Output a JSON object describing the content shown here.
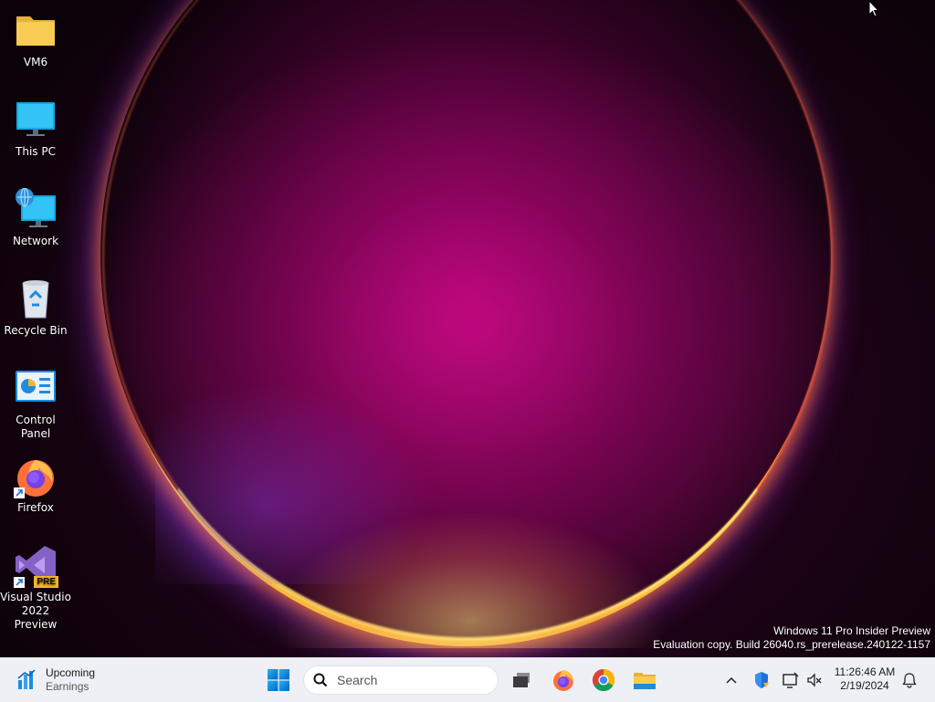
{
  "desktop": {
    "icons": [
      {
        "label": "VM6",
        "icon": "folder-icon"
      },
      {
        "label": "This PC",
        "icon": "monitor-icon"
      },
      {
        "label": "Network",
        "icon": "network-icon"
      },
      {
        "label": "Recycle Bin",
        "icon": "recycle-bin-icon"
      },
      {
        "label": "Control Panel",
        "icon": "control-panel-icon"
      },
      {
        "label": "Firefox",
        "icon": "firefox-icon"
      },
      {
        "label": "Visual Studio 2022 Preview",
        "line1": "Visual Studio",
        "line2": "2022 Preview",
        "icon": "visual-studio-icon",
        "badge": "PRE"
      }
    ],
    "watermark": {
      "line1": "Windows 11 Pro Insider Preview",
      "line2": "Evaluation copy. Build 26040.rs_prerelease.240122-1157"
    }
  },
  "taskbar": {
    "widget": {
      "title": "Upcoming",
      "subtitle": "Earnings",
      "icon": "stocks-chart-icon"
    },
    "start_icon": "windows-start-icon",
    "search": {
      "placeholder": "Search",
      "icon": "search-icon"
    },
    "apps": [
      {
        "name": "task-view",
        "icon": "task-view-icon"
      },
      {
        "name": "firefox",
        "icon": "firefox-icon"
      },
      {
        "name": "chrome",
        "icon": "chrome-icon"
      },
      {
        "name": "file-explorer",
        "icon": "file-explorer-icon"
      }
    ],
    "tray": {
      "icons": [
        "chevron-up-icon",
        "security-shield-icon",
        "network-status-icon",
        "volume-muted-icon"
      ]
    },
    "clock": {
      "time": "11:26:46 AM",
      "date": "2/19/2024"
    },
    "notification_icon": "bell-icon"
  },
  "colors": {
    "taskbar_bg": "#eef0f5",
    "accent_blue": "#0078d4",
    "wallpaper_magenta": "#c8107a"
  }
}
